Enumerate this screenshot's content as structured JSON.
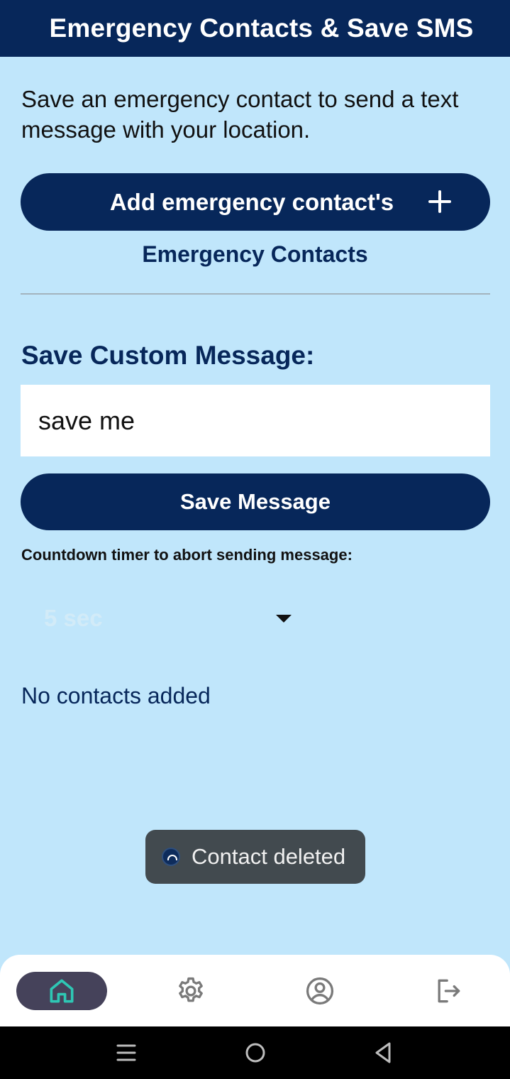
{
  "app_bar": {
    "title": "Emergency Contacts & Save SMS"
  },
  "intro": {
    "text": "Save an emergency contact to send a text message with your location."
  },
  "add_contact_button": {
    "label": "Add emergency contact's",
    "icon": "plus-icon"
  },
  "contacts_link": {
    "label": "Emergency Contacts"
  },
  "custom_message": {
    "title": "Save Custom Message:",
    "input_value": "save me",
    "save_button_label": "Save Message"
  },
  "countdown": {
    "label": "Countdown timer to abort sending message:",
    "selected_value": "5 sec"
  },
  "contacts_list": {
    "empty_text": "No contacts added"
  },
  "toast": {
    "text": "Contact deleted",
    "icon": "app-logo-icon"
  },
  "bottom_nav": {
    "items": [
      {
        "id": "home",
        "icon": "home-icon",
        "active": true
      },
      {
        "id": "settings",
        "icon": "gear-icon",
        "active": false
      },
      {
        "id": "profile",
        "icon": "user-circle-icon",
        "active": false
      },
      {
        "id": "logout",
        "icon": "logout-icon",
        "active": false
      }
    ]
  },
  "colors": {
    "primary": "#07275a",
    "background": "#c0e6fb",
    "active_nav": "#45425a",
    "active_icon": "#2ec7b4",
    "inactive_icon": "#7a7a7a"
  }
}
